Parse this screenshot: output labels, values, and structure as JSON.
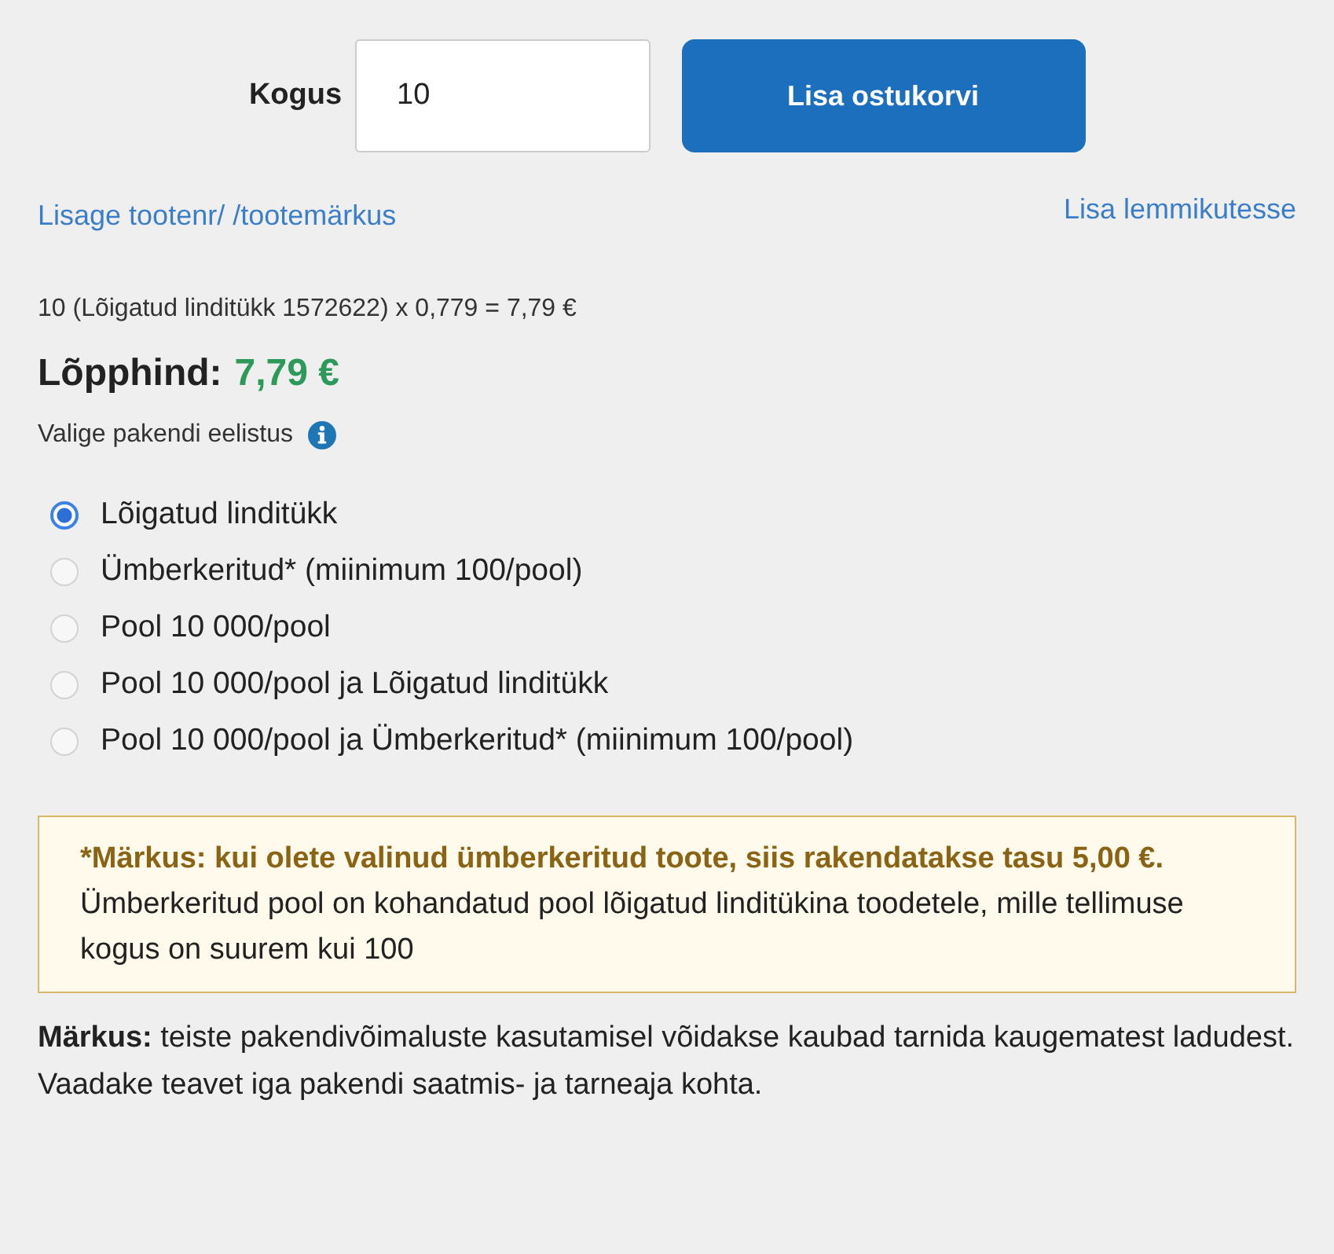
{
  "quantity": {
    "label": "Kogus",
    "value": "10"
  },
  "add_to_cart_button": "Lisa ostukorvi",
  "links": {
    "left": "Lisage tootenr/ /tootemärkus",
    "right": "Lisa lemmikutesse"
  },
  "calculation": "10 (Lõigatud linditükk 1572622) x 0,779 = 7,79 €",
  "total": {
    "label": "Lõpphind:",
    "value": "7,79 €"
  },
  "packaging": {
    "label": "Valige pakendi eelistus",
    "options": [
      {
        "label": "Lõigatud linditükk",
        "selected": true
      },
      {
        "label": "Ümberkeritud* (miinimum 100/pool)",
        "selected": false
      },
      {
        "label": "Pool 10 000/pool",
        "selected": false
      },
      {
        "label": "Pool 10 000/pool ja Lõigatud linditükk",
        "selected": false
      },
      {
        "label": "Pool 10 000/pool ja Ümberkeritud* (miinimum 100/pool)",
        "selected": false
      }
    ]
  },
  "notice": {
    "title": "*Märkus: kui olete valinud ümberkeritud toote, siis rakendatakse tasu 5,00 €.",
    "text": "Ümberkeritud pool on kohandatud pool lõigatud linditükina toodetele, mille tellimuse kogus on suurem kui 100"
  },
  "footnote": "**Märkus:** teiste pakendivõimaluste kasutamisel võidakse kaubad tarnida kaugematest ladudest. Vaadake teavet iga pakendi saatmis- ja tarneaja kohta."
}
